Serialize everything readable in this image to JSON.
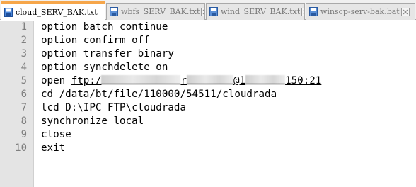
{
  "tabs": [
    {
      "label": "cloud_SERV_BAK.txt",
      "active": true
    },
    {
      "label": "wbfs_SERV_BAK.txt",
      "active": false
    },
    {
      "label": "wind_SERV_BAK.txt",
      "active": false
    },
    {
      "label": "winscp-serv-bak.bat",
      "active": false
    }
  ],
  "editor": {
    "line_numbers": [
      "1",
      "2",
      "3",
      "4",
      "5",
      "6",
      "7",
      "8",
      "9",
      "10"
    ],
    "lines": {
      "l1": "option batch continue",
      "l2": "option confirm off",
      "l3": "option transfer binary",
      "l4": "option synchdelete on",
      "l5_prefix": "open ",
      "l5_link_start": "ftp:/",
      "l5_link_mid": "r",
      "l5_link_end": "@1",
      "l5_link_tail": "150:21",
      "l6": "cd /data/bt/file/110000/54511/cloudrada",
      "l7": "lcd D:\\IPC_FTP\\cloudrada",
      "l8": "synchronize local",
      "l9": "close",
      "l10": "exit"
    }
  },
  "colors": {
    "active_tab_accent": "#f6a64a",
    "gutter_bg": "#e4e4e4",
    "caret": "#8a2be2"
  }
}
